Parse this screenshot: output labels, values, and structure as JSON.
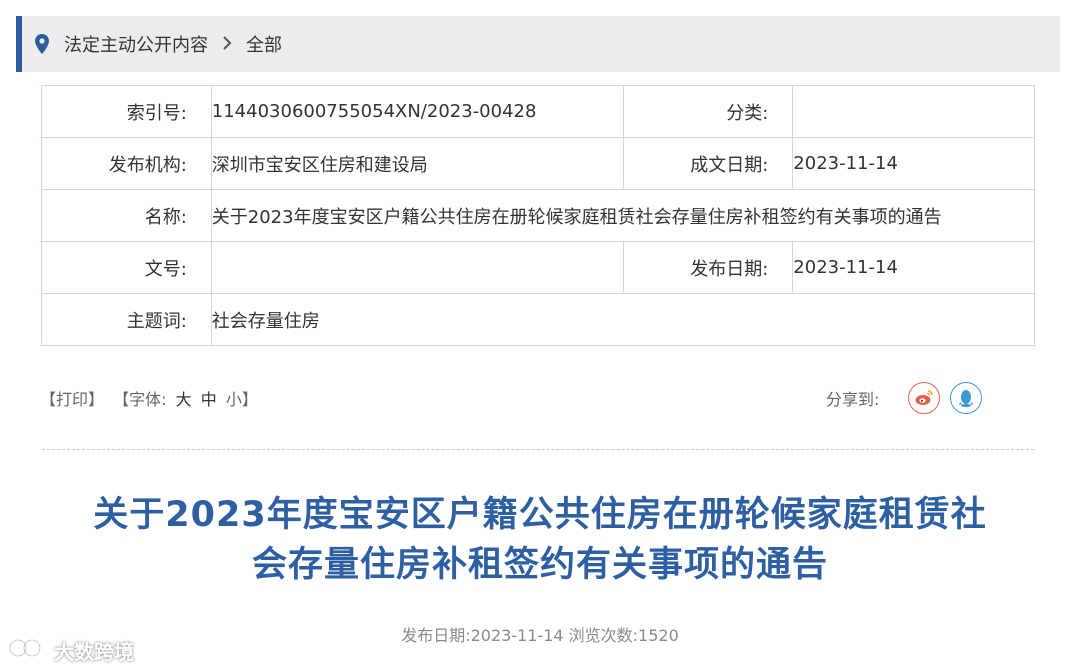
{
  "breadcrumb": {
    "section": "法定主动公开内容",
    "current": "全部"
  },
  "meta": {
    "index_label": "索引号:",
    "index_value": "1144030600755054XN/2023-00428",
    "category_label": "分类:",
    "category_value": "",
    "publisher_label": "发布机构:",
    "publisher_value": "深圳市宝安区住房和建设局",
    "written_date_label": "成文日期:",
    "written_date_value": "2023-11-14",
    "name_label": "名称:",
    "name_value": "关于2023年度宝安区户籍公共住房在册轮候家庭租赁社会存量住房补租签约有关事项的通告",
    "doc_no_label": "文号:",
    "doc_no_value": "",
    "publish_date_label": "发布日期:",
    "publish_date_value": "2023-11-14",
    "keywords_label": "主题词:",
    "keywords_value": "社会存量住房"
  },
  "tools": {
    "print": "【打印】",
    "font_prefix": "【字体:",
    "font_large": "大",
    "font_medium": "中",
    "font_small": "小】",
    "share_label": "分享到:"
  },
  "article": {
    "title_line1": "关于2023年度宝安区户籍公共住房在册轮候家庭租赁社",
    "title_line2": "会存量住房补租签约有关事项的通告",
    "publish_info": "发布日期:2023-11-14 浏览次数:1520"
  },
  "watermark": "大数跨境",
  "colors": {
    "accent": "#2d5c9c",
    "title": "#2e5fa2",
    "table_border": "#c9d9e6",
    "weibo": "#e6604a",
    "qq": "#3f99d6"
  },
  "icons": [
    "location-pin-icon",
    "chevron-right-icon",
    "weibo-icon",
    "qq-icon",
    "watermark-logo-icon"
  ]
}
